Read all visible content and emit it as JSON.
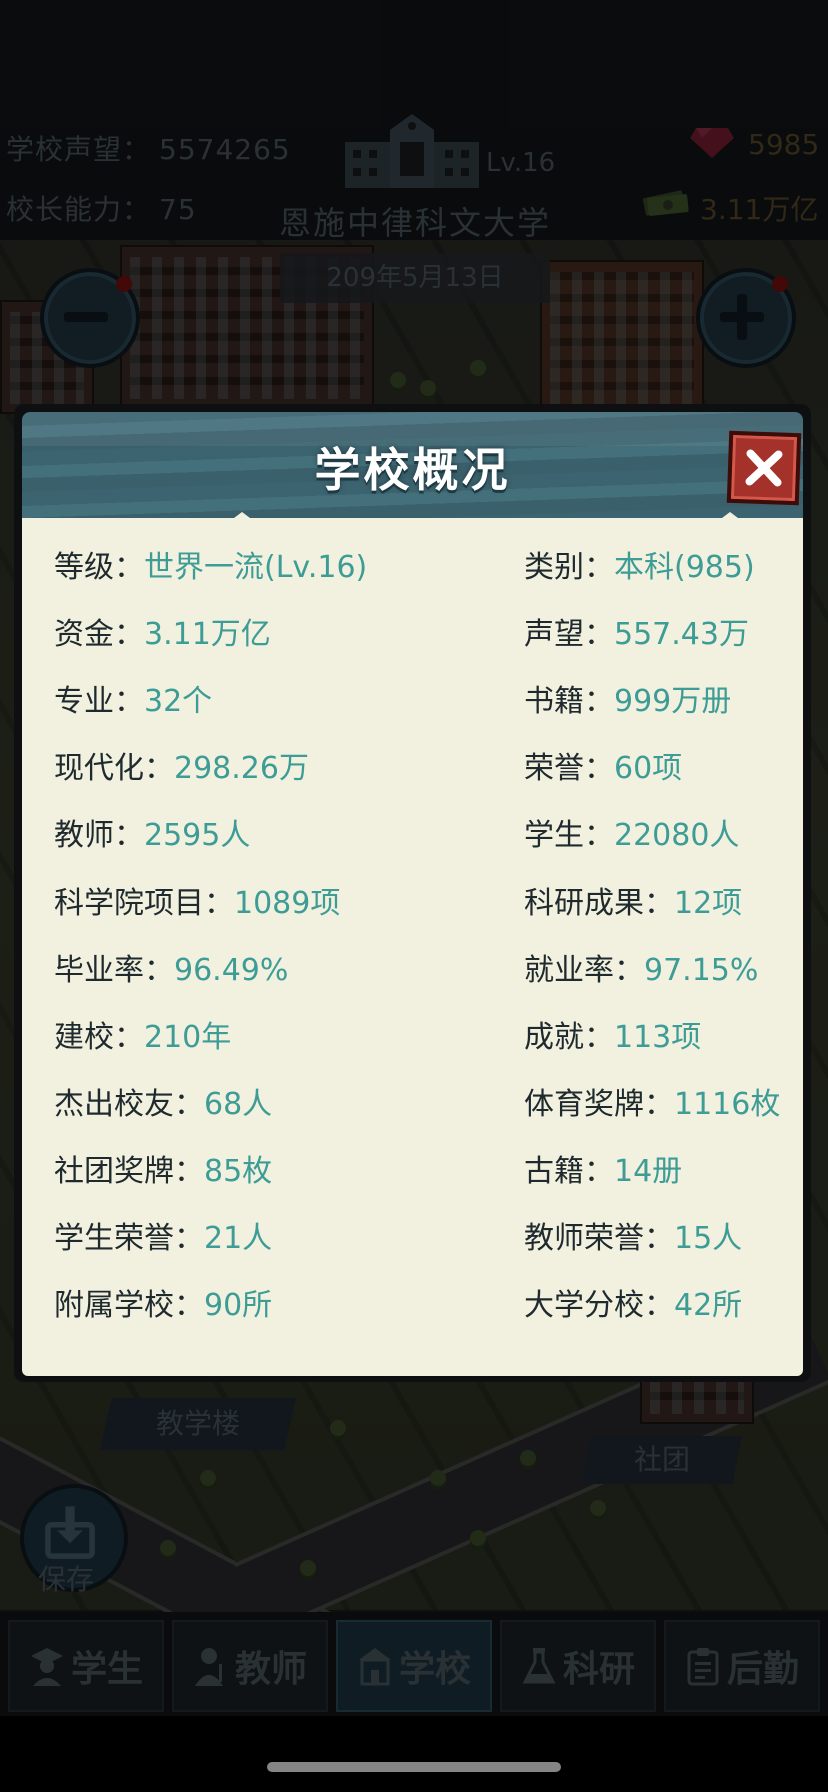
{
  "hud": {
    "reputation_label": "学校声望：",
    "reputation_value": "5574265",
    "ability_label": "校长能力：",
    "ability_value": "75",
    "level": "Lv.16",
    "school_name": "恩施中律科文大学",
    "gems": "5985",
    "money": "3.11万亿",
    "date": "209年5月13日"
  },
  "map_labels": {
    "teaching_building": "教学楼",
    "club": "社团",
    "save": "保存"
  },
  "modal": {
    "title": "学校概况",
    "left": [
      {
        "label": "等级：",
        "value": "世界一流(Lv.16)"
      },
      {
        "label": "资金：",
        "value": "3.11万亿"
      },
      {
        "label": "专业：",
        "value": "32个"
      },
      {
        "label": "现代化：",
        "value": "298.26万"
      },
      {
        "label": "教师：",
        "value": "2595人"
      },
      {
        "label": "科学院项目：",
        "value": "1089项"
      },
      {
        "label": "毕业率：",
        "value": "96.49%"
      },
      {
        "label": "建校：",
        "value": "210年"
      },
      {
        "label": "杰出校友：",
        "value": "68人"
      },
      {
        "label": "社团奖牌：",
        "value": "85枚"
      },
      {
        "label": "学生荣誉：",
        "value": "21人"
      },
      {
        "label": "附属学校：",
        "value": "90所"
      }
    ],
    "right": [
      {
        "label": "类别：",
        "value": "本科(985)"
      },
      {
        "label": "声望：",
        "value": "557.43万"
      },
      {
        "label": "书籍：",
        "value": "999万册"
      },
      {
        "label": "荣誉：",
        "value": "60项"
      },
      {
        "label": "学生：",
        "value": "22080人"
      },
      {
        "label": "科研成果：",
        "value": "12项"
      },
      {
        "label": "就业率：",
        "value": "97.15%"
      },
      {
        "label": "成就：",
        "value": "113项"
      },
      {
        "label": "体育奖牌：",
        "value": "1116枚"
      },
      {
        "label": "古籍：",
        "value": "14册"
      },
      {
        "label": "教师荣誉：",
        "value": "15人"
      },
      {
        "label": "大学分校：",
        "value": "42所"
      }
    ]
  },
  "tabs": [
    {
      "label": "学生",
      "icon": "student-icon"
    },
    {
      "label": "教师",
      "icon": "teacher-icon"
    },
    {
      "label": "学校",
      "icon": "school-icon"
    },
    {
      "label": "科研",
      "icon": "flask-icon"
    },
    {
      "label": "后勤",
      "icon": "clipboard-icon"
    }
  ],
  "colors": {
    "label": "#1f2a2f",
    "value": "#3d9c96",
    "header": "#3f6a76",
    "close": "#a4322a",
    "panel": "#f2f1df"
  }
}
